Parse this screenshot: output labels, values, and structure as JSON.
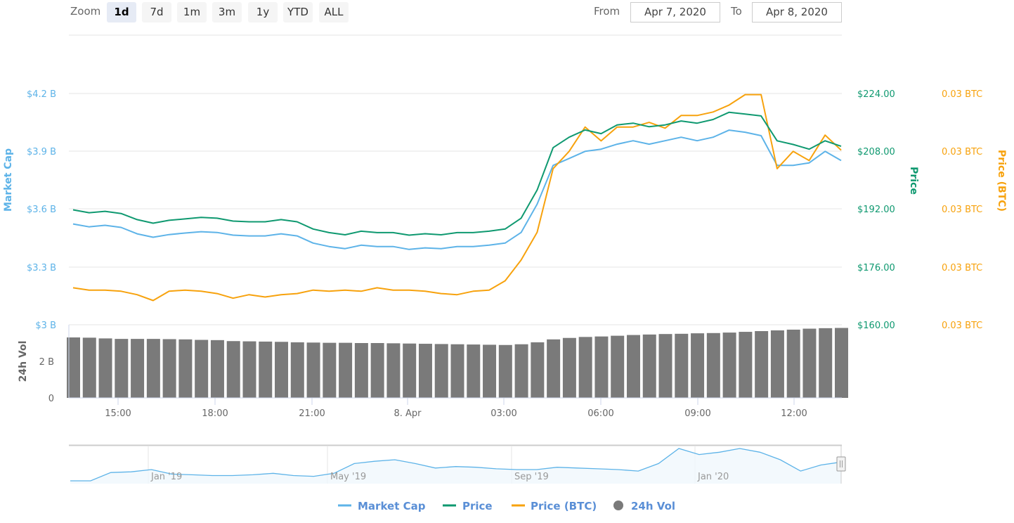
{
  "toolbar": {
    "zoom_label": "Zoom",
    "buttons": [
      "1d",
      "7d",
      "1m",
      "3m",
      "1y",
      "YTD",
      "ALL"
    ],
    "active": "1d",
    "from_label": "From",
    "from_value": "Apr 7, 2020",
    "to_label": "To",
    "to_value": "Apr 8, 2020"
  },
  "colors": {
    "market_cap": "#5db3e8",
    "price": "#0f9970",
    "price_btc": "#f7a20d",
    "volume": "#7a7a7a",
    "legend_text": "#5a8fd6"
  },
  "chart_data": {
    "type": "line",
    "x_start": "Apr 7, 2020 13:36",
    "x_interval_minutes": 30,
    "x_ticks": [
      "15:00",
      "18:00",
      "21:00",
      "8. Apr",
      "03:00",
      "06:00",
      "09:00",
      "12:00"
    ],
    "axes": {
      "market_cap": {
        "title": "Market Cap",
        "ticks": [
          "$4.2 B",
          "$3.9 B",
          "$3.6 B",
          "$3.3 B",
          "$3 B"
        ],
        "range": [
          3.0,
          4.2
        ]
      },
      "price": {
        "title": "Price",
        "ticks": [
          "$224.00",
          "$208.00",
          "$192.00",
          "$176.00",
          "$160.00"
        ],
        "range": [
          160,
          224
        ]
      },
      "price_btc": {
        "title": "Price (BTC)",
        "ticks": [
          "0.03 BTC",
          "0.03 BTC",
          "0.03 BTC",
          "0.03 BTC",
          "0.03 BTC"
        ],
        "range": [
          0.029,
          0.031
        ]
      },
      "volume": {
        "title": "24h Vol",
        "ticks": [
          "$3 B",
          "2 B",
          "0"
        ],
        "range": [
          0,
          3
        ]
      }
    },
    "series": [
      {
        "name": "Market Cap",
        "unit": "B USD",
        "values": [
          3.523,
          3.508,
          3.516,
          3.505,
          3.472,
          3.454,
          3.468,
          3.476,
          3.483,
          3.479,
          3.465,
          3.461,
          3.461,
          3.472,
          3.461,
          3.424,
          3.406,
          3.395,
          3.413,
          3.406,
          3.406,
          3.391,
          3.399,
          3.395,
          3.406,
          3.406,
          3.413,
          3.424,
          3.479,
          3.626,
          3.827,
          3.863,
          3.9,
          3.911,
          3.937,
          3.955,
          3.937,
          3.955,
          3.973,
          3.955,
          3.973,
          4.01,
          3.999,
          3.981,
          3.827,
          3.827,
          3.84,
          3.9,
          3.852
        ]
      },
      {
        "name": "Price",
        "unit": "USD",
        "values": [
          191.8,
          191.0,
          191.4,
          190.8,
          189.1,
          188.1,
          188.9,
          189.3,
          189.7,
          189.5,
          188.7,
          188.5,
          188.5,
          189.1,
          188.5,
          186.5,
          185.5,
          184.9,
          185.9,
          185.5,
          185.5,
          184.8,
          185.2,
          184.9,
          185.5,
          185.5,
          185.9,
          186.5,
          189.5,
          197.3,
          209.0,
          211.9,
          213.9,
          212.9,
          215.3,
          215.8,
          214.8,
          215.3,
          216.4,
          215.8,
          216.8,
          218.8,
          218.3,
          217.8,
          210.9,
          209.9,
          208.6,
          210.9,
          209.4
        ]
      },
      {
        "name": "Price (BTC)",
        "unit": "BTC",
        "values": [
          0.02932,
          0.0293,
          0.0293,
          0.02929,
          0.02926,
          0.02921,
          0.02929,
          0.0293,
          0.02929,
          0.02927,
          0.02923,
          0.02926,
          0.02924,
          0.02926,
          0.02927,
          0.0293,
          0.02929,
          0.0293,
          0.02929,
          0.02932,
          0.0293,
          0.0293,
          0.02929,
          0.02927,
          0.02926,
          0.02929,
          0.0293,
          0.02938,
          0.02956,
          0.0298,
          0.03035,
          0.0305,
          0.03071,
          0.03059,
          0.03071,
          0.03071,
          0.03075,
          0.0307,
          0.03081,
          0.03081,
          0.03084,
          0.0309,
          0.03099,
          0.03099,
          0.03035,
          0.0305,
          0.03042,
          0.03064,
          0.03051
        ]
      },
      {
        "name": "24h Vol",
        "unit": "B USD",
        "values": [
          2.48,
          2.47,
          2.44,
          2.42,
          2.42,
          2.42,
          2.41,
          2.4,
          2.38,
          2.37,
          2.33,
          2.32,
          2.31,
          2.3,
          2.28,
          2.27,
          2.26,
          2.26,
          2.25,
          2.25,
          2.24,
          2.23,
          2.22,
          2.21,
          2.2,
          2.19,
          2.18,
          2.17,
          2.2,
          2.28,
          2.4,
          2.46,
          2.5,
          2.52,
          2.55,
          2.58,
          2.6,
          2.62,
          2.63,
          2.65,
          2.66,
          2.68,
          2.71,
          2.74,
          2.77,
          2.8,
          2.84,
          2.86,
          2.87
        ]
      }
    ],
    "legend": {
      "position": "bottom-center",
      "items": [
        "Market Cap",
        "Price",
        "Price (BTC)",
        "24h Vol"
      ]
    },
    "grid": true
  },
  "navigator": {
    "ticks": [
      "Jan '19",
      "May '19",
      "Sep '19",
      "Jan '20"
    ],
    "series": [
      2.2,
      2.2,
      4.4,
      4.6,
      5.2,
      4.0,
      3.8,
      3.6,
      3.6,
      3.8,
      4.2,
      3.6,
      3.4,
      4.2,
      6.8,
      7.4,
      7.8,
      6.8,
      5.6,
      6.0,
      5.8,
      5.4,
      5.2,
      5.2,
      5.8,
      5.6,
      5.4,
      5.2,
      4.8,
      6.8,
      10.8,
      9.2,
      9.8,
      10.8,
      9.8,
      7.8,
      4.8,
      6.4,
      7.2
    ]
  }
}
